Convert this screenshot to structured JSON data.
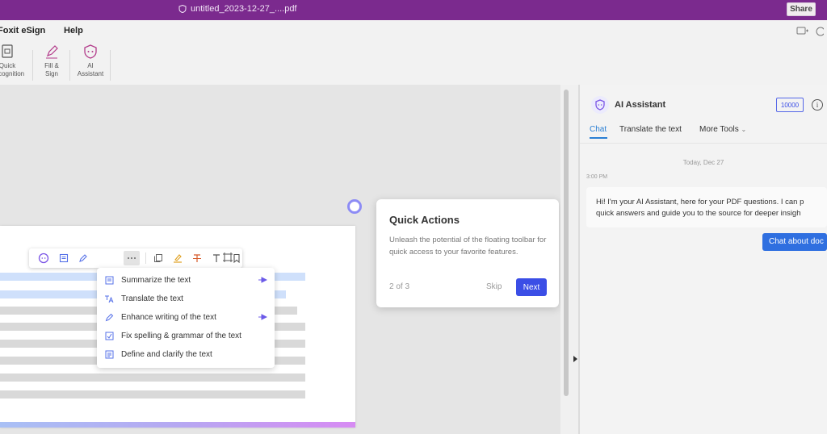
{
  "window": {
    "doc_title": "untitled_2023-12-27_....pdf",
    "share_label": "Share"
  },
  "menu": {
    "items": [
      "Foxit eSign",
      "Help"
    ],
    "right_icons": [
      "comment-icon",
      "settings-icon"
    ]
  },
  "ribbon": {
    "tools": [
      {
        "line1": "Quick",
        "line2": "Recognition",
        "icon": "quick-recognition-icon"
      },
      {
        "line1": "Fill &",
        "line2": "Sign",
        "icon": "fill-sign-icon"
      },
      {
        "line1": "AI",
        "line2": "Assistant",
        "icon": "ai-assistant-icon"
      }
    ]
  },
  "float_toolbar": {
    "icons": [
      "ai-icon",
      "summary-icon",
      "enhance-icon",
      "more-icon",
      "copy-icon",
      "highlight-icon",
      "strikethrough-icon",
      "text-icon",
      "bookmark-icon",
      "crop-icon"
    ]
  },
  "quick_actions_menu": {
    "items": [
      {
        "label": "Summarize the text",
        "icon": "summarize-icon",
        "pinned": true
      },
      {
        "label": "Translate the text",
        "icon": "translate-icon",
        "pinned": false
      },
      {
        "label": "Enhance writing of the text",
        "icon": "enhance-icon",
        "pinned": true
      },
      {
        "label": "Fix spelling & grammar of the text",
        "icon": "spell-check-icon",
        "pinned": false
      },
      {
        "label": "Define and clarify the text",
        "icon": "define-icon",
        "pinned": false
      }
    ]
  },
  "coachmark": {
    "title": "Quick Actions",
    "body": "Unleash the potential of the floating toolbar for quick access to your favorite features.",
    "step": "2 of 3",
    "skip_label": "Skip",
    "next_label": "Next"
  },
  "ai_panel": {
    "title": "AI Assistant",
    "credits": "10000",
    "tabs": [
      "Chat",
      "Translate the text",
      "More Tools"
    ],
    "active_tab": "Chat",
    "date_label": "Today, Dec 27",
    "time_label": "3:00 PM",
    "message_line1": "Hi! I'm your AI Assistant, here for your PDF questions. I can p",
    "message_line2": "quick answers and guide you to the source for deeper insigh",
    "chat_button": "Chat about doc"
  },
  "colors": {
    "title_bar": "#7b2a8e",
    "accent": "#3b4ee6",
    "tab_active": "#2a7fd4"
  }
}
